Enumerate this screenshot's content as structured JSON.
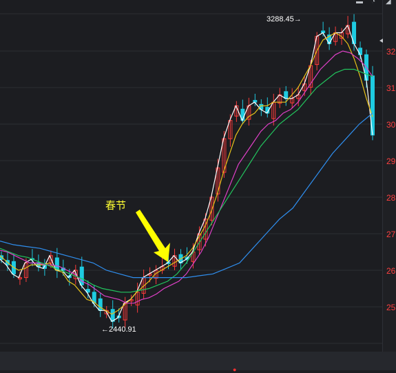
{
  "chart_data": {
    "type": "line",
    "title": "",
    "y_tick_labels": [
      "32",
      "31",
      "30",
      "29",
      "28",
      "27",
      "26",
      "25"
    ],
    "y_ticks": [
      3200,
      3100,
      3000,
      2900,
      2800,
      2700,
      2600,
      2500
    ],
    "ylim": [
      2380,
      3320
    ],
    "grid": true,
    "annotations": {
      "high_label": "3288.45",
      "low_label": "2440.91",
      "event_label": "春节"
    },
    "colors": {
      "up": "#ff3b3b",
      "down": "#1ecbe1",
      "ma5": "#ffffff",
      "ma10": "#e8c21a",
      "ma20": "#e040c8",
      "ma30": "#22c55e",
      "ma60": "#2f8ff0",
      "arrow": "#ffff00"
    },
    "series": [
      {
        "name": "",
        "color": "#ffffff",
        "values": [
          2630,
          2615,
          2590,
          2580,
          2620,
          2630,
          2610,
          2605,
          2640,
          2600,
          2600,
          2580,
          2600,
          2560,
          2540,
          2510,
          2490,
          2490,
          2460,
          2470,
          2510,
          2520,
          2540,
          2580,
          2590,
          2600,
          2610,
          2620,
          2640,
          2620,
          2630,
          2650,
          2700,
          2740,
          2800,
          2880,
          2960,
          3010,
          3050,
          3010,
          3050,
          3060,
          3040,
          3030,
          3060,
          3080,
          3070,
          3070,
          3080,
          3110,
          3160,
          3240,
          3250,
          3220,
          3250,
          3250,
          3270,
          3220,
          3190,
          3120,
          2970
        ]
      },
      {
        "name": "",
        "color": "#e8c21a",
        "values": [
          2640,
          2625,
          2610,
          2600,
          2605,
          2615,
          2615,
          2615,
          2620,
          2600,
          2595,
          2570,
          2560,
          2540,
          2520,
          2515,
          2500,
          2490,
          2480,
          2490,
          2505,
          2520,
          2540,
          2555,
          2570,
          2590,
          2600,
          2610,
          2620,
          2630,
          2640,
          2660,
          2690,
          2720,
          2760,
          2810,
          2870,
          2920,
          2970,
          3000,
          3020,
          3030,
          3050,
          3050,
          3060,
          3060,
          3060,
          3080,
          3100,
          3130,
          3160,
          3200,
          3230,
          3240,
          3250,
          3240,
          3220,
          3180,
          3130,
          3070,
          3020
        ]
      },
      {
        "name": "",
        "color": "#e040c8",
        "values": [
          2655,
          2650,
          2640,
          2630,
          2620,
          2620,
          2615,
          2615,
          2610,
          2600,
          2590,
          2570,
          2560,
          2545,
          2530,
          2525,
          2520,
          2510,
          2510,
          2520,
          2525,
          2535,
          2550,
          2560,
          2570,
          2590,
          2620,
          2650,
          2690,
          2740,
          2790,
          2840,
          2890,
          2920,
          2950,
          2980,
          3000,
          3010,
          3030,
          3040,
          3060,
          3090,
          3120,
          3150,
          3170,
          3190,
          3200,
          3195,
          3180,
          3160,
          3130
        ]
      },
      {
        "name": "",
        "color": "#22c55e",
        "values": [
          2660,
          2650,
          2640,
          2635,
          2625,
          2615,
          2605,
          2595,
          2585,
          2575,
          2560,
          2550,
          2545,
          2540,
          2540,
          2545,
          2550,
          2560,
          2570,
          2590,
          2620,
          2660,
          2700,
          2740,
          2780,
          2820,
          2860,
          2900,
          2940,
          2970,
          3000,
          3020,
          3040,
          3070,
          3100,
          3120,
          3140,
          3150,
          3150,
          3140,
          3130
        ]
      },
      {
        "name": "",
        "color": "#2f8ff0",
        "values": [
          2680,
          2670,
          2665,
          2660,
          2650,
          2640,
          2630,
          2620,
          2600,
          2590,
          2580,
          2580,
          2580,
          2580,
          2580,
          2585,
          2590,
          2605,
          2620,
          2660,
          2700,
          2740,
          2770,
          2820,
          2870,
          2920,
          2960,
          3000,
          3030
        ]
      }
    ]
  }
}
